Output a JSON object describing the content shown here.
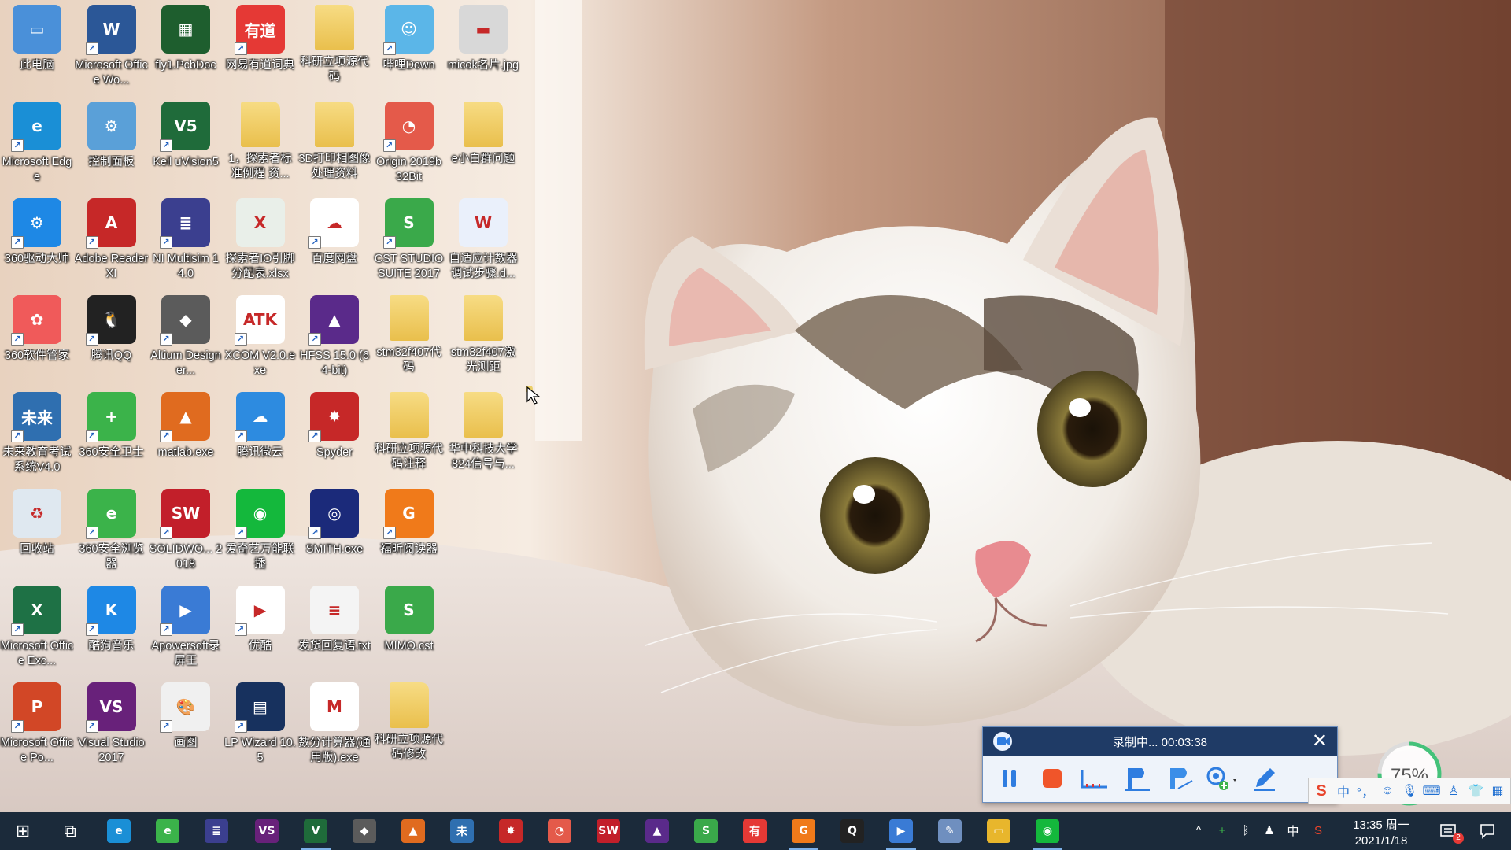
{
  "desktop": {
    "icons": [
      {
        "label": "此电脑",
        "icon": "this-pc-icon",
        "col": 0,
        "row": 0,
        "bg": "#4a90d9",
        "glyph": "▭",
        "shortcut": false
      },
      {
        "label": "Microsoft Office Wo...",
        "icon": "word-doc-icon",
        "col": 1,
        "row": 0,
        "bg": "#2b5797",
        "glyph": "W",
        "shortcut": true
      },
      {
        "label": "fly1.PcbDoc",
        "icon": "pcb-doc-icon",
        "col": 2,
        "row": 0,
        "bg": "#1e5e2e",
        "glyph": "▦",
        "shortcut": false
      },
      {
        "label": "网易有道词典",
        "icon": "youdao-icon",
        "col": 3,
        "row": 0,
        "bg": "#e53935",
        "glyph": "有道",
        "shortcut": true
      },
      {
        "label": "科研立项源代码",
        "icon": "folder-icon",
        "col": 4,
        "row": 0,
        "bg": "#f2d06b",
        "glyph": "",
        "shortcut": false
      },
      {
        "label": "哔哩Down",
        "icon": "bilidown-icon",
        "col": 5,
        "row": 0,
        "bg": "#5bb6e8",
        "glyph": "☺",
        "shortcut": true
      },
      {
        "label": "micok名片.jpg",
        "icon": "image-file-icon",
        "col": 6,
        "row": 0,
        "bg": "#d8d8d8",
        "glyph": "▬",
        "shortcut": false
      },
      {
        "label": "Microsoft Edge",
        "icon": "edge-icon",
        "col": 0,
        "row": 1,
        "bg": "#1a8fd6",
        "glyph": "e",
        "shortcut": true
      },
      {
        "label": "控制面板",
        "icon": "control-panel-icon",
        "col": 1,
        "row": 1,
        "bg": "#5aa0d8",
        "glyph": "⚙",
        "shortcut": false
      },
      {
        "label": "Keil uVision5",
        "icon": "keil-icon",
        "col": 2,
        "row": 1,
        "bg": "#1f6b3a",
        "glyph": "V5",
        "shortcut": true
      },
      {
        "label": "1，探索者标准例程 资...",
        "icon": "folder-icon",
        "col": 3,
        "row": 1,
        "bg": "#f2d06b",
        "glyph": "",
        "shortcut": false
      },
      {
        "label": "3D打印相图像处理资料",
        "icon": "folder-icon",
        "col": 4,
        "row": 1,
        "bg": "#f2d06b",
        "glyph": "",
        "shortcut": false
      },
      {
        "label": "Origin 2019b 32Bit",
        "icon": "origin-icon",
        "col": 5,
        "row": 1,
        "bg": "#e45a4a",
        "glyph": "◔",
        "shortcut": true
      },
      {
        "label": "e小白群问题",
        "icon": "folder-icon",
        "col": 6,
        "row": 1,
        "bg": "#f2d06b",
        "glyph": "",
        "shortcut": false
      },
      {
        "label": "360驱动大师",
        "icon": "driver-master-icon",
        "col": 0,
        "row": 2,
        "bg": "#1e88e5",
        "glyph": "⚙",
        "shortcut": true
      },
      {
        "label": "Adobe Reader XI",
        "icon": "adobe-reader-icon",
        "col": 1,
        "row": 2,
        "bg": "#c62828",
        "glyph": "A",
        "shortcut": true
      },
      {
        "label": "NI Multisim 14.0",
        "icon": "multisim-icon",
        "col": 2,
        "row": 2,
        "bg": "#3b3f8f",
        "glyph": "≣",
        "shortcut": true
      },
      {
        "label": "探索者IO引脚分配表.xlsx",
        "icon": "excel-file-icon",
        "col": 3,
        "row": 2,
        "bg": "#e9efe9",
        "glyph": "X",
        "shortcut": false
      },
      {
        "label": "百度网盘",
        "icon": "baidu-netdisk-icon",
        "col": 4,
        "row": 2,
        "bg": "#ffffff",
        "glyph": "☁",
        "shortcut": true
      },
      {
        "label": "CST STUDIO SUITE 2017",
        "icon": "cst-icon",
        "col": 5,
        "row": 2,
        "bg": "#3aa94a",
        "glyph": "S",
        "shortcut": true
      },
      {
        "label": "自适应计数器调试步骤.d...",
        "icon": "word-file-icon",
        "col": 6,
        "row": 2,
        "bg": "#eaf0fb",
        "glyph": "W",
        "shortcut": false
      },
      {
        "label": "360软件管家",
        "icon": "software-manager-icon",
        "col": 0,
        "row": 3,
        "bg": "#f05a5a",
        "glyph": "✿",
        "shortcut": true
      },
      {
        "label": "腾讯QQ",
        "icon": "qq-icon",
        "col": 1,
        "row": 3,
        "bg": "#222222",
        "glyph": "🐧",
        "shortcut": true
      },
      {
        "label": "Altium Designer...",
        "icon": "altium-icon",
        "col": 2,
        "row": 3,
        "bg": "#5b5b5b",
        "glyph": "◆",
        "shortcut": true
      },
      {
        "label": "XCOM V2.0.exe",
        "icon": "xcom-icon",
        "col": 3,
        "row": 3,
        "bg": "#ffffff",
        "glyph": "ATK",
        "shortcut": true
      },
      {
        "label": "HFSS 15.0 (64-bit)",
        "icon": "hfss-icon",
        "col": 4,
        "row": 3,
        "bg": "#5a2a8a",
        "glyph": "▲",
        "shortcut": true
      },
      {
        "label": "stm32f407代码",
        "icon": "folder-icon",
        "col": 5,
        "row": 3,
        "bg": "#f2d06b",
        "glyph": "",
        "shortcut": false
      },
      {
        "label": "stm32f407激光测距",
        "icon": "folder-icon",
        "col": 6,
        "row": 3,
        "bg": "#f2d06b",
        "glyph": "",
        "shortcut": false
      },
      {
        "label": "未来教育考试系统V4.0",
        "icon": "future-edu-icon",
        "col": 0,
        "row": 4,
        "bg": "#2f6fb0",
        "glyph": "未来",
        "shortcut": true
      },
      {
        "label": "360安全卫士",
        "icon": "360-safe-icon",
        "col": 1,
        "row": 4,
        "bg": "#3bb34a",
        "glyph": "+",
        "shortcut": true
      },
      {
        "label": "matlab.exe",
        "icon": "matlab-icon",
        "col": 2,
        "row": 4,
        "bg": "#e06b1f",
        "glyph": "▲",
        "shortcut": true
      },
      {
        "label": "腾讯微云",
        "icon": "weiyun-icon",
        "col": 3,
        "row": 4,
        "bg": "#2d8be0",
        "glyph": "☁",
        "shortcut": true
      },
      {
        "label": "Spyder",
        "icon": "spyder-icon",
        "col": 4,
        "row": 4,
        "bg": "#c62828",
        "glyph": "✸",
        "shortcut": true
      },
      {
        "label": "科研立项源代码注释",
        "icon": "folder-icon",
        "col": 5,
        "row": 4,
        "bg": "#f2d06b",
        "glyph": "",
        "shortcut": false
      },
      {
        "label": "华中科技大学824信号与...",
        "icon": "folder-icon",
        "col": 6,
        "row": 4,
        "bg": "#f2d06b",
        "glyph": "",
        "shortcut": false
      },
      {
        "label": "回收站",
        "icon": "recycle-bin-icon",
        "col": 0,
        "row": 5,
        "bg": "#dfe8f0",
        "glyph": "♻",
        "shortcut": false
      },
      {
        "label": "360安全浏览器",
        "icon": "360-browser-icon",
        "col": 1,
        "row": 5,
        "bg": "#3bb34a",
        "glyph": "e",
        "shortcut": true
      },
      {
        "label": "SOLIDWO... 2018",
        "icon": "solidworks-icon",
        "col": 2,
        "row": 5,
        "bg": "#c21f2a",
        "glyph": "SW",
        "shortcut": true
      },
      {
        "label": "爱奇艺万能联播",
        "icon": "iqiyi-icon",
        "col": 3,
        "row": 5,
        "bg": "#14b83c",
        "glyph": "◉",
        "shortcut": true
      },
      {
        "label": "SMITH.exe",
        "icon": "smith-chart-icon",
        "col": 4,
        "row": 5,
        "bg": "#1b2a7a",
        "glyph": "◎",
        "shortcut": true
      },
      {
        "label": "福昕阅读器",
        "icon": "foxit-reader-icon",
        "col": 5,
        "row": 5,
        "bg": "#f07a1a",
        "glyph": "G",
        "shortcut": true
      },
      {
        "label": "Microsoft Office Exc...",
        "icon": "excel-icon",
        "col": 0,
        "row": 6,
        "bg": "#1e7145",
        "glyph": "X",
        "shortcut": true
      },
      {
        "label": "酷狗音乐",
        "icon": "kugou-icon",
        "col": 1,
        "row": 6,
        "bg": "#1e88e5",
        "glyph": "K",
        "shortcut": true
      },
      {
        "label": "Apowersoft录屏王",
        "icon": "apowersoft-icon",
        "col": 2,
        "row": 6,
        "bg": "#3a7bd5",
        "glyph": "▶",
        "shortcut": true
      },
      {
        "label": "优酷",
        "icon": "youku-icon",
        "col": 3,
        "row": 6,
        "bg": "#ffffff",
        "glyph": "▶",
        "shortcut": true
      },
      {
        "label": "发货回复语.txt",
        "icon": "text-file-icon",
        "col": 4,
        "row": 6,
        "bg": "#f4f4f4",
        "glyph": "≡",
        "shortcut": false
      },
      {
        "label": "MIMO.cst",
        "icon": "cst-file-icon",
        "col": 5,
        "row": 6,
        "bg": "#3aa94a",
        "glyph": "S",
        "shortcut": false
      },
      {
        "label": "Microsoft Office Po...",
        "icon": "powerpoint-icon",
        "col": 0,
        "row": 7,
        "bg": "#d24726",
        "glyph": "P",
        "shortcut": true
      },
      {
        "label": "Visual Studio 2017",
        "icon": "visual-studio-icon",
        "col": 1,
        "row": 7,
        "bg": "#68217a",
        "glyph": "VS",
        "shortcut": true
      },
      {
        "label": "画图",
        "icon": "paint-icon",
        "col": 2,
        "row": 7,
        "bg": "#f0f0f0",
        "glyph": "🎨",
        "shortcut": true
      },
      {
        "label": "LP Wizard 10.5",
        "icon": "lp-wizard-icon",
        "col": 3,
        "row": 7,
        "bg": "#17315e",
        "glyph": "▤",
        "shortcut": true
      },
      {
        "label": "数分计算器(通用版).exe",
        "icon": "calculator-icon",
        "col": 4,
        "row": 7,
        "bg": "#ffffff",
        "glyph": "M",
        "shortcut": false
      },
      {
        "label": "科研立项源代码修改",
        "icon": "folder-icon",
        "col": 5,
        "row": 7,
        "bg": "#f2d06b",
        "glyph": "",
        "shortcut": false
      }
    ]
  },
  "recorder": {
    "status": "录制中... 00:03:38",
    "close_label": "✕",
    "tools": [
      "pause-icon",
      "stop-icon",
      "line-tool-icon",
      "pen-tool-icon",
      "marker-tool-icon",
      "zoom-tool-icon",
      "edit-pencil-icon"
    ]
  },
  "volume": {
    "percent_text": "75%",
    "level": 75
  },
  "ime": {
    "items": [
      "sogou-icon",
      "中",
      "°，",
      "☺",
      "mic-icon",
      "keyboard-icon",
      "user-icon",
      "shirt-icon",
      "grid-icon"
    ]
  },
  "taskbar": {
    "buttons": [
      {
        "name": "start-button",
        "icon": "windows-start-icon",
        "glyph": "⊞",
        "bg": "transparent",
        "active": false
      },
      {
        "name": "task-view-button",
        "icon": "task-view-icon",
        "glyph": "⧉",
        "bg": "transparent",
        "active": false
      },
      {
        "name": "taskbar-edge",
        "icon": "edge-icon",
        "glyph": "e",
        "bg": "#1a8fd6",
        "active": false
      },
      {
        "name": "taskbar-360-browser",
        "icon": "360-browser-icon",
        "glyph": "e",
        "bg": "#3bb34a",
        "active": false
      },
      {
        "name": "taskbar-multisim",
        "icon": "multisim-icon",
        "glyph": "≣",
        "bg": "#3b3f8f",
        "active": false
      },
      {
        "name": "taskbar-visual-studio",
        "icon": "visual-studio-icon",
        "glyph": "VS",
        "bg": "#68217a",
        "active": false
      },
      {
        "name": "taskbar-keil",
        "icon": "keil-icon",
        "glyph": "V",
        "bg": "#1f6b3a",
        "active": true
      },
      {
        "name": "taskbar-altium",
        "icon": "altium-icon",
        "glyph": "◆",
        "bg": "#5b5b5b",
        "active": false
      },
      {
        "name": "taskbar-matlab",
        "icon": "matlab-icon",
        "glyph": "▲",
        "bg": "#e06b1f",
        "active": false
      },
      {
        "name": "taskbar-future-edu",
        "icon": "future-edu-icon",
        "glyph": "未",
        "bg": "#2f6fb0",
        "active": false
      },
      {
        "name": "taskbar-spyder",
        "icon": "spyder-icon",
        "glyph": "✸",
        "bg": "#c62828",
        "active": false
      },
      {
        "name": "taskbar-origin",
        "icon": "origin-icon",
        "glyph": "◔",
        "bg": "#e45a4a",
        "active": false
      },
      {
        "name": "taskbar-solidworks",
        "icon": "solidworks-icon",
        "glyph": "SW",
        "bg": "#c21f2a",
        "active": false
      },
      {
        "name": "taskbar-hfss",
        "icon": "hfss-icon",
        "glyph": "▲",
        "bg": "#5a2a8a",
        "active": false
      },
      {
        "name": "taskbar-cst",
        "icon": "cst-icon",
        "glyph": "S",
        "bg": "#3aa94a",
        "active": false
      },
      {
        "name": "taskbar-youdao",
        "icon": "youdao-icon",
        "glyph": "有",
        "bg": "#e53935",
        "active": false
      },
      {
        "name": "taskbar-foxit",
        "icon": "foxit-reader-icon",
        "glyph": "G",
        "bg": "#f07a1a",
        "active": true
      },
      {
        "name": "taskbar-qq",
        "icon": "qq-icon",
        "glyph": "Q",
        "bg": "#222222",
        "active": false
      },
      {
        "name": "taskbar-apowersoft",
        "icon": "apowersoft-icon",
        "glyph": "▶",
        "bg": "#3a7bd5",
        "active": true
      },
      {
        "name": "taskbar-paint",
        "icon": "paint-icon",
        "glyph": "✎",
        "bg": "#6f8fbf",
        "active": false
      },
      {
        "name": "taskbar-file-explorer",
        "icon": "file-explorer-icon",
        "glyph": "▭",
        "bg": "#e8b62c",
        "active": false
      },
      {
        "name": "taskbar-iqiyi",
        "icon": "iqiyi-icon",
        "glyph": "◉",
        "bg": "#14b83c",
        "active": true
      }
    ],
    "tray": {
      "items": [
        {
          "name": "show-hidden-icons",
          "icon": "chevron-up-icon",
          "glyph": "^"
        },
        {
          "name": "tray-360",
          "icon": "360-safe-icon",
          "glyph": "+"
        },
        {
          "name": "tray-bluetooth",
          "icon": "bluetooth-icon",
          "glyph": "ᛒ"
        },
        {
          "name": "tray-qq",
          "icon": "qq-icon",
          "glyph": "♟"
        },
        {
          "name": "tray-ime-language",
          "icon": "ime-language-icon",
          "glyph": "中"
        },
        {
          "name": "tray-sogou",
          "icon": "sogou-icon",
          "glyph": "S"
        }
      ],
      "time": "13:35 周一",
      "date": "2021/1/18",
      "notification_count": "2"
    }
  }
}
